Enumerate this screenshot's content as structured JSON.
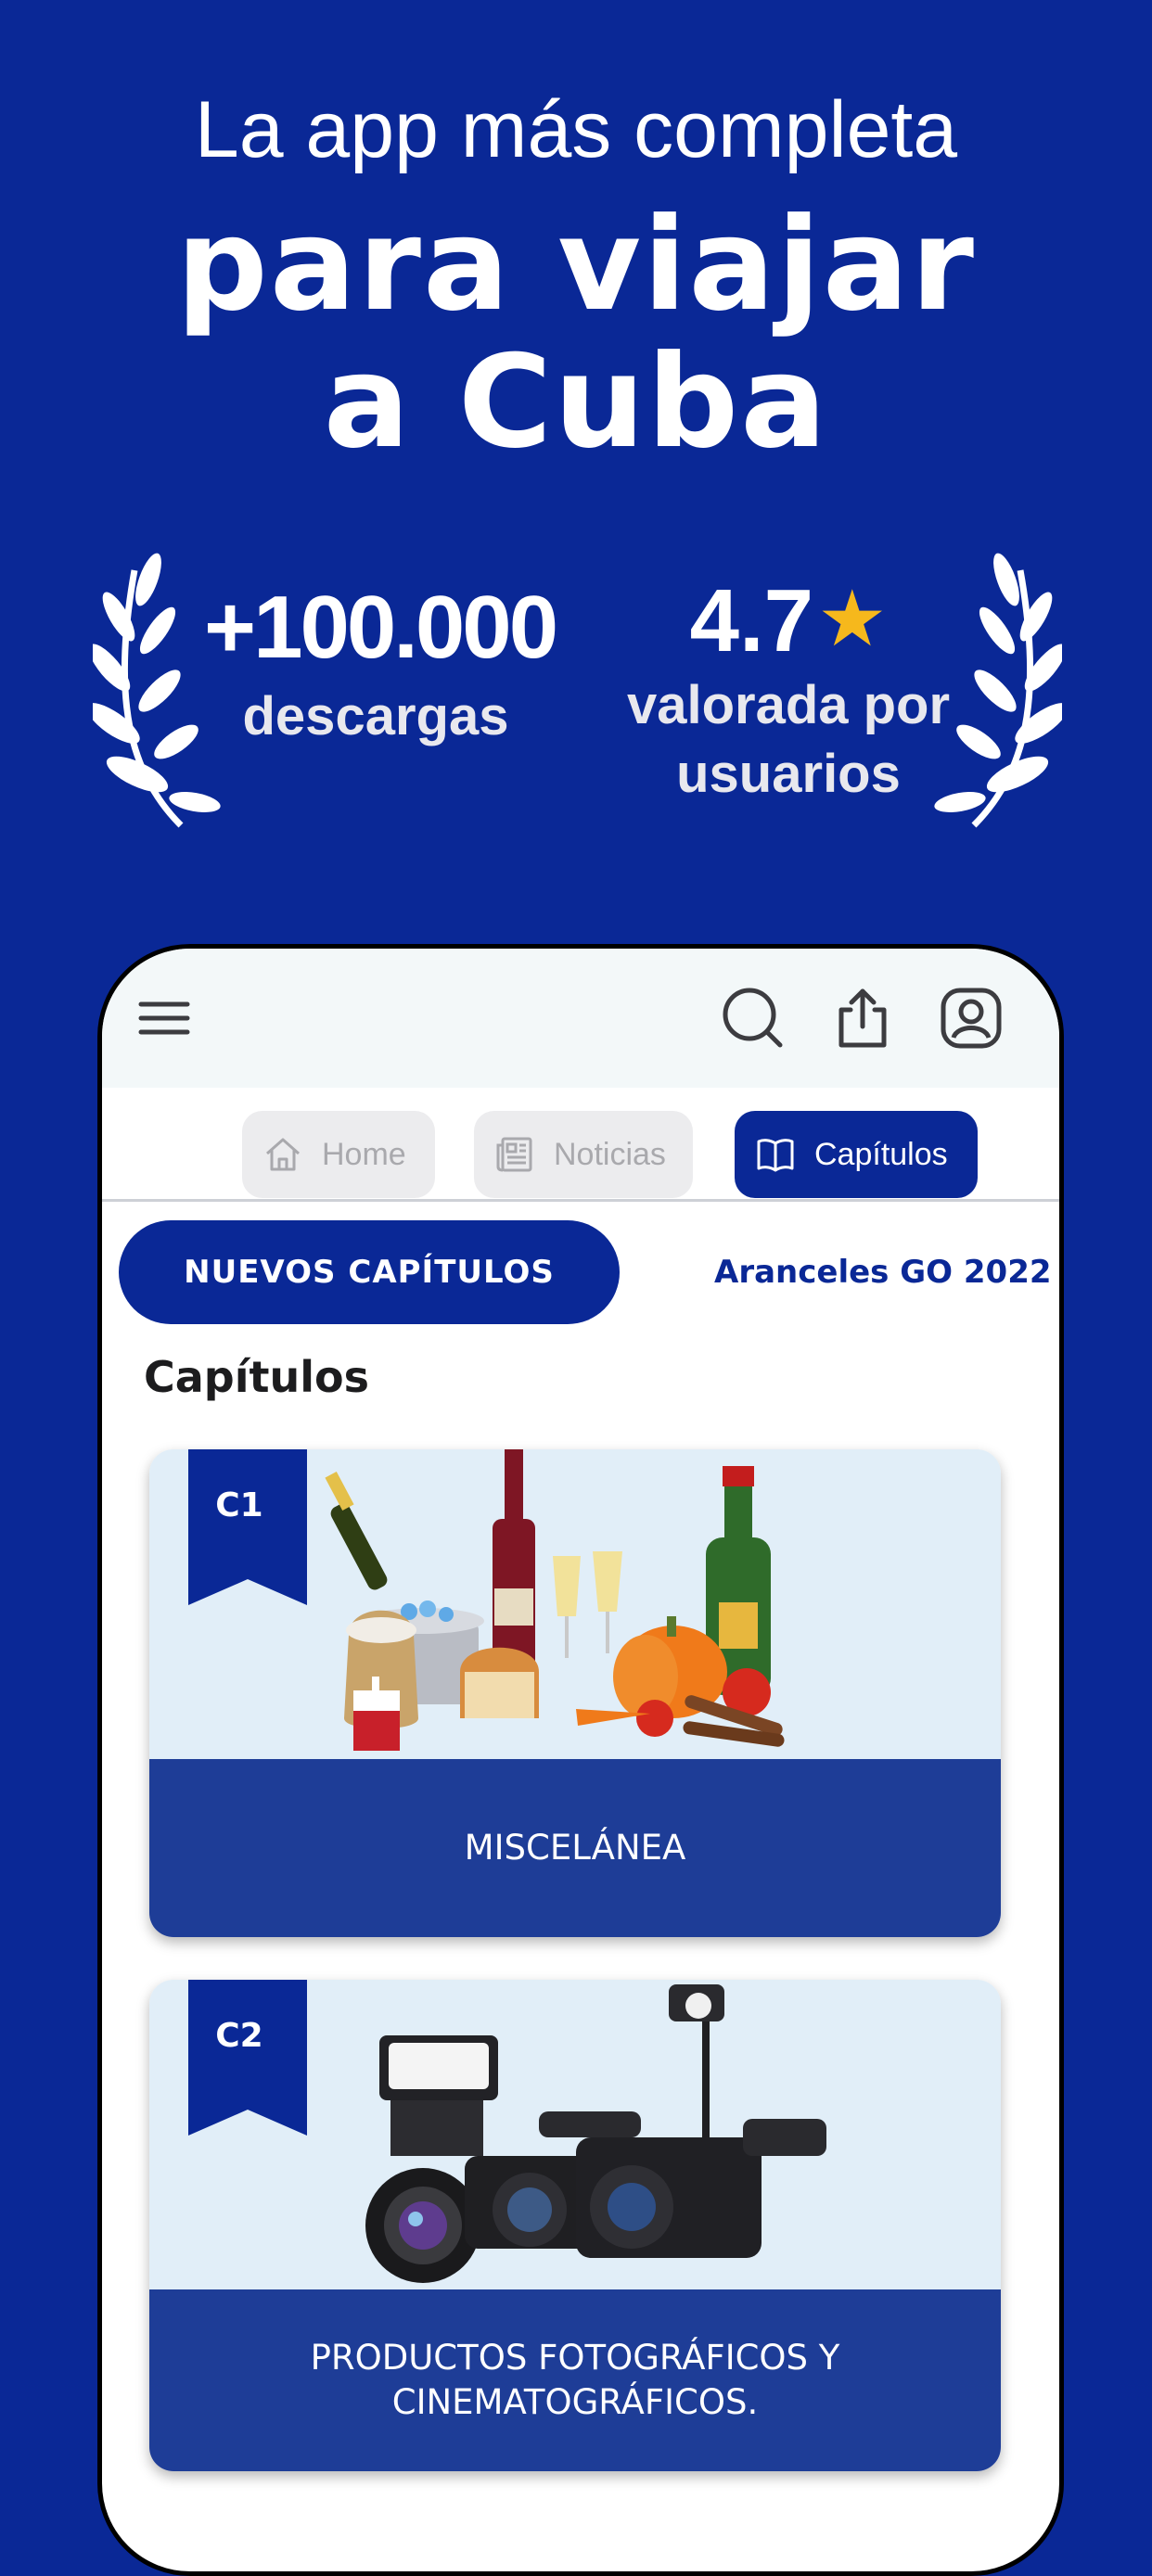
{
  "hero": {
    "line1": "La app más completa",
    "title_line1": "para viajar",
    "title_line2": "a Cuba"
  },
  "stats": {
    "downloads_value": "+100.000",
    "downloads_label": "descargas",
    "rating_value": "4.7",
    "rating_icon": "star-icon",
    "rating_label_line1": "valorada por",
    "rating_label_line2": "usuarios"
  },
  "app": {
    "topbar_icons": [
      "menu-icon",
      "search-icon",
      "share-icon",
      "profile-icon"
    ],
    "tabs": [
      {
        "label": "Home",
        "icon": "home-icon"
      },
      {
        "label": "Noticias",
        "icon": "newspaper-icon"
      },
      {
        "label": "Capítulos",
        "icon": "book-icon",
        "active": true
      }
    ],
    "pills": {
      "new_chapters": "NUEVOS CAPÍTULOS",
      "aranceles": "Aranceles GO 2022"
    },
    "section_title": "Capítulos",
    "chapters": [
      {
        "code": "C1",
        "title": "MISCELÁNEA"
      },
      {
        "code": "C2",
        "title": "PRODUCTOS FOTOGRÁFICOS Y CINEMATOGRÁFICOS."
      }
    ]
  },
  "colors": {
    "background": "#0a2896",
    "card_banner": "#1e3d97",
    "star": "#f6b81c",
    "topbar": "#f3f8f9"
  }
}
